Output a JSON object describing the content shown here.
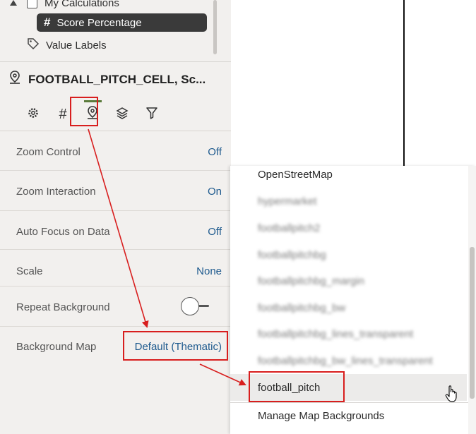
{
  "data_panel": {
    "tree": {
      "my_calculations": "My Calculations",
      "score_percentage": "Score Percentage",
      "value_labels": "Value Labels"
    }
  },
  "visualization": {
    "title": "FOOTBALL_PITCH_CELL, Sc...",
    "tabs": [
      {
        "icon": "gear-icon",
        "active": false
      },
      {
        "icon": "hash-icon",
        "active": false
      },
      {
        "icon": "map-pin-icon",
        "active": true
      },
      {
        "icon": "layers-icon",
        "active": false
      },
      {
        "icon": "filter-icon",
        "active": false
      }
    ]
  },
  "properties": {
    "zoom_control": {
      "label": "Zoom Control",
      "value": "Off"
    },
    "zoom_interaction": {
      "label": "Zoom Interaction",
      "value": "On"
    },
    "auto_focus": {
      "label": "Auto Focus on Data",
      "value": "Off"
    },
    "scale": {
      "label": "Scale",
      "value": "None"
    },
    "repeat_background": {
      "label": "Repeat Background",
      "toggle": "off"
    },
    "background_map": {
      "label": "Background Map",
      "value": "Default (Thematic)"
    }
  },
  "dropdown": {
    "items": [
      "OpenStreetMap",
      "hypermarket",
      "footballpitch2",
      "footballpitchbg",
      "footballpitchbg_margin",
      "footballpitchbg_bw",
      "footballpitchbg_lines_transparent",
      "footballpitchbg_bw_lines_transparent",
      "football_pitch"
    ],
    "manage": "Manage Map Backgrounds"
  },
  "colors": {
    "highlight": "#d81e1e",
    "link": "#1e5a8e",
    "active_tab": "#5a7a3a"
  }
}
